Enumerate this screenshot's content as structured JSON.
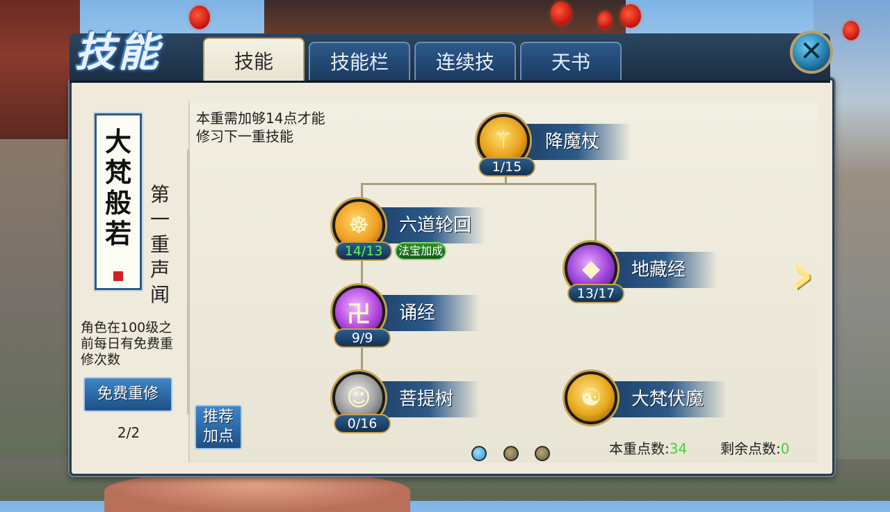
{
  "header": {
    "title": "技能",
    "tabs": [
      {
        "label": "技能",
        "active": true
      },
      {
        "label": "技能栏",
        "active": false
      },
      {
        "label": "连续技",
        "active": false
      },
      {
        "label": "天书",
        "active": false
      }
    ],
    "close_icon": "close-x-icon"
  },
  "sidebar": {
    "school_name": "大梵般若",
    "stage_label": "第一重声闻",
    "note": "角色在100级之前每日有免费重修次数",
    "free_reset_label": "免费重修",
    "free_reset_count": "2/2"
  },
  "tree": {
    "requirement_text": "本重需加够14点才能修习下一重技能",
    "recommend_label": "推荐加点",
    "skills": [
      {
        "name": "降魔杖",
        "level": "1/15",
        "icon": "staff-icon",
        "color": "#e8a01a"
      },
      {
        "name": "六道轮回",
        "level": "14/13",
        "icon": "wheel-icon",
        "color": "#f0a020",
        "badge": "法宝加成",
        "over_cap": true
      },
      {
        "name": "地藏经",
        "level": "13/17",
        "icon": "crystal-icon",
        "color": "#9b3fd6"
      },
      {
        "name": "诵经",
        "level": "9/9",
        "icon": "swastika-icon",
        "color": "#b146e0"
      },
      {
        "name": "菩提树",
        "level": "0/16",
        "icon": "figure-icon",
        "color": "#9a9a9a"
      },
      {
        "name": "大梵伏魔",
        "level": "",
        "icon": "buddha-icon",
        "color": "#e8a71a"
      }
    ]
  },
  "pagination": {
    "pages": 3,
    "current": 1
  },
  "footer": {
    "stage_points_label": "本重点数:",
    "stage_points_value": "34",
    "remaining_points_label": "剩余点数:",
    "remaining_points_value": "0"
  }
}
